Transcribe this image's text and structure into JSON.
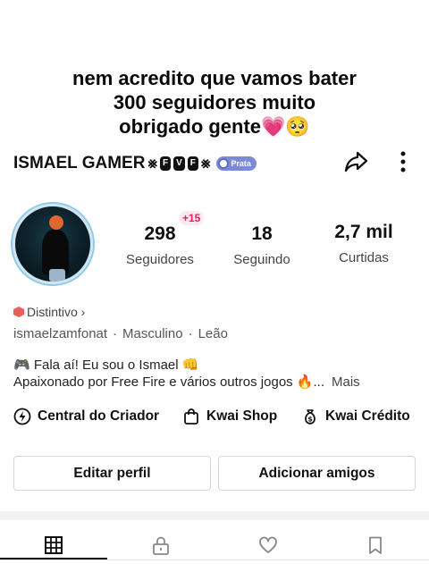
{
  "caption": {
    "line1": "nem acredito que vamos bater",
    "line2": "300 seguidores muito",
    "line3": "obrigado gente💗🥺"
  },
  "profile": {
    "name": "ISMAEL GAMER",
    "deco_left": "⨳",
    "tag_letters": [
      "F",
      "V",
      "F"
    ],
    "deco_right": "⨳",
    "level_badge": "Prata"
  },
  "stats": {
    "followers_delta": "+15",
    "followers": "298",
    "followers_label": "Seguidores",
    "following": "18",
    "following_label": "Seguindo",
    "likes": "2,7 mil",
    "likes_label": "Curtidas"
  },
  "badge_link": "Distintivo ›",
  "meta": {
    "handle": "ismaelzamfonat",
    "gender": "Masculino",
    "sign": "Leão"
  },
  "bio": {
    "line1": "🎮 Fala aí! Eu sou o Ismael 👊",
    "line2": "Apaixonado por Free Fire e vários outros jogos 🔥...",
    "more": "Mais"
  },
  "actions": {
    "creator": "Central do Criador",
    "shop": "Kwai Shop",
    "credit": "Kwai Crédito"
  },
  "buttons": {
    "edit": "Editar perfil",
    "add_friends": "Adicionar amigos"
  },
  "colors": {
    "badge_blue": "#7b8bd6",
    "delta_pink": "#e0245e",
    "distintivo_red": "#e7615a"
  }
}
